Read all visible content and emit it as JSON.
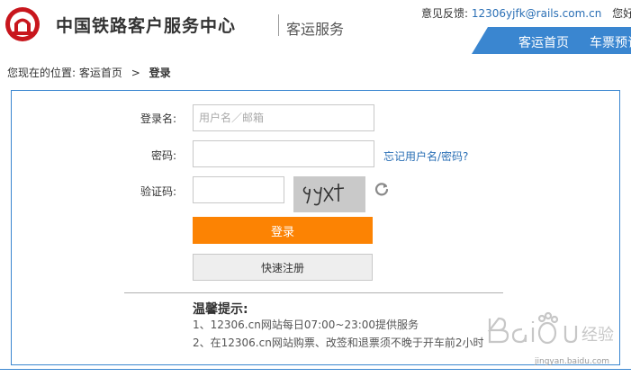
{
  "header": {
    "brand": "中国铁路客户服务中心",
    "subbrand": "客运服务",
    "feedback_label": "意见反馈:",
    "feedback_email": "12306yjfk@rails.com.cn",
    "greeting": "您好，请",
    "nav": {
      "home": "客运首页",
      "ticket": "车票预订"
    },
    "accent_color": "#3a86d0",
    "logo_icon": "railway-logo-icon"
  },
  "breadcrumb": {
    "prefix": "您现在的位置:",
    "home": "客运首页",
    "separator": ">",
    "current": "登录"
  },
  "form": {
    "username_label": "登录名:",
    "username_placeholder": "用户名／邮箱",
    "password_label": "密码:",
    "forgot_link": "忘记用户名/密码?",
    "captcha_label": "验证码:",
    "captcha_text": "9yxt",
    "refresh_icon": "refresh-icon",
    "login_button": "登录",
    "login_color": "#fc8303",
    "register_button": "快速注册"
  },
  "tips": {
    "title": "温馨提示:",
    "items": [
      "1、12306.cn网站每日07:00~23:00提供服务",
      "2、在12306.cn网站购票、改签和退票须不晚于开车前2小时"
    ]
  },
  "watermark": {
    "logo": "Bai度经验",
    "url": "jingyan.baidu.com"
  }
}
